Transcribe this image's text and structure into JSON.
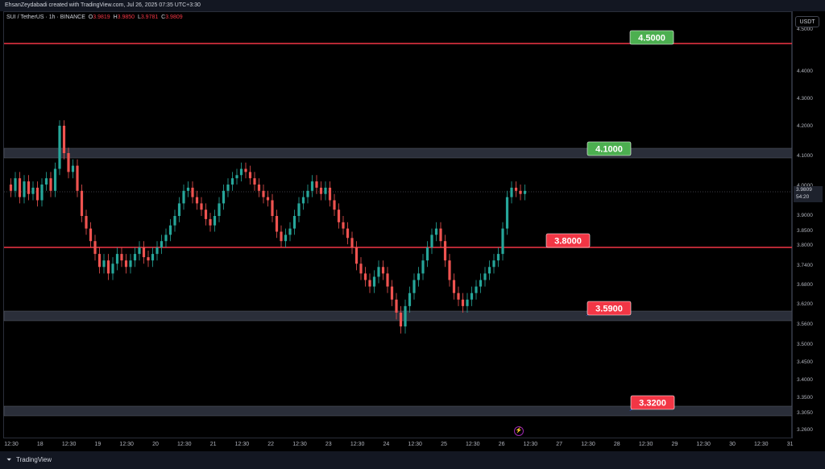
{
  "header": {
    "credit": "EhsanZeydabadi created with TradingView.com, Jul 26, 2025 07:35 UTC+3:30"
  },
  "symbol": {
    "name": "SUI / TetherUS · 1h · BINANCE",
    "o_label": "O",
    "o": "3.9819",
    "h_label": "H",
    "h": "3.9850",
    "l_label": "L",
    "l": "3.9781",
    "c_label": "C",
    "c": "3.9809"
  },
  "currency": "USDT",
  "last_price": {
    "value": "3.9809",
    "countdown": "54:20"
  },
  "price_axis": [
    "4.5000",
    "4.4000",
    "4.3000",
    "4.2000",
    "4.1000",
    "4.0000",
    "3.9000",
    "3.8500",
    "3.8000",
    "3.7400",
    "3.6800",
    "3.6200",
    "3.5600",
    "3.5000",
    "3.4500",
    "3.4000",
    "3.3500",
    "3.3050",
    "3.2600"
  ],
  "time_axis": [
    "12:30",
    "18",
    "12:30",
    "19",
    "12:30",
    "20",
    "12:30",
    "21",
    "12:30",
    "22",
    "12:30",
    "23",
    "12:30",
    "24",
    "12:30",
    "25",
    "12:30",
    "26",
    "12:30",
    "27",
    "12:30",
    "28",
    "12:30",
    "29",
    "12:30",
    "30",
    "12:30",
    "31"
  ],
  "levels": [
    {
      "label": "4.5000",
      "color": "#4caf50",
      "kind": "line"
    },
    {
      "label": "4.1000",
      "color": "#4caf50",
      "kind": "zone"
    },
    {
      "label": "3.8000",
      "color": "#f23645",
      "kind": "line"
    },
    {
      "label": "3.5900",
      "color": "#f23645",
      "kind": "zone"
    },
    {
      "label": "3.3200",
      "color": "#f23645",
      "kind": "zone"
    }
  ],
  "colors": {
    "up": "#26a69a",
    "down": "#ef5350",
    "line": "#f23645",
    "zone": "#434651"
  },
  "footer": {
    "brand": "TradingView",
    "logo_icon": "tradingview-logo-icon"
  },
  "chart_data": {
    "type": "candlestick",
    "title": "SUI / TetherUS · 1h · BINANCE",
    "ylim": [
      3.26,
      4.54
    ],
    "close_path": [
      4.0,
      3.98,
      4.02,
      3.96,
      4.01,
      3.97,
      3.99,
      3.95,
      4.0,
      4.02,
      3.98,
      4.05,
      4.2,
      4.1,
      4.04,
      4.06,
      3.98,
      3.9,
      3.86,
      3.82,
      3.78,
      3.74,
      3.76,
      3.72,
      3.75,
      3.78,
      3.76,
      3.74,
      3.76,
      3.78,
      3.8,
      3.77,
      3.76,
      3.78,
      3.8,
      3.82,
      3.84,
      3.87,
      3.9,
      3.94,
      3.98,
      3.99,
      3.96,
      3.94,
      3.92,
      3.89,
      3.87,
      3.9,
      3.94,
      3.98,
      4.0,
      4.02,
      4.03,
      4.05,
      4.04,
      4.02,
      4.0,
      3.98,
      3.96,
      3.95,
      3.9,
      3.85,
      3.82,
      3.84,
      3.86,
      3.9,
      3.94,
      3.96,
      3.98,
      4.01,
      3.99,
      3.97,
      3.99,
      3.95,
      3.92,
      3.88,
      3.86,
      3.83,
      3.8,
      3.75,
      3.72,
      3.7,
      3.68,
      3.71,
      3.74,
      3.72,
      3.68,
      3.64,
      3.6,
      3.56,
      3.62,
      3.66,
      3.7,
      3.72,
      3.76,
      3.8,
      3.84,
      3.86,
      3.82,
      3.76,
      3.7,
      3.66,
      3.64,
      3.62,
      3.64,
      3.66,
      3.68,
      3.7,
      3.72,
      3.74,
      3.76,
      3.78,
      3.86,
      3.96,
      3.99,
      3.98,
      3.97,
      3.98
    ]
  }
}
